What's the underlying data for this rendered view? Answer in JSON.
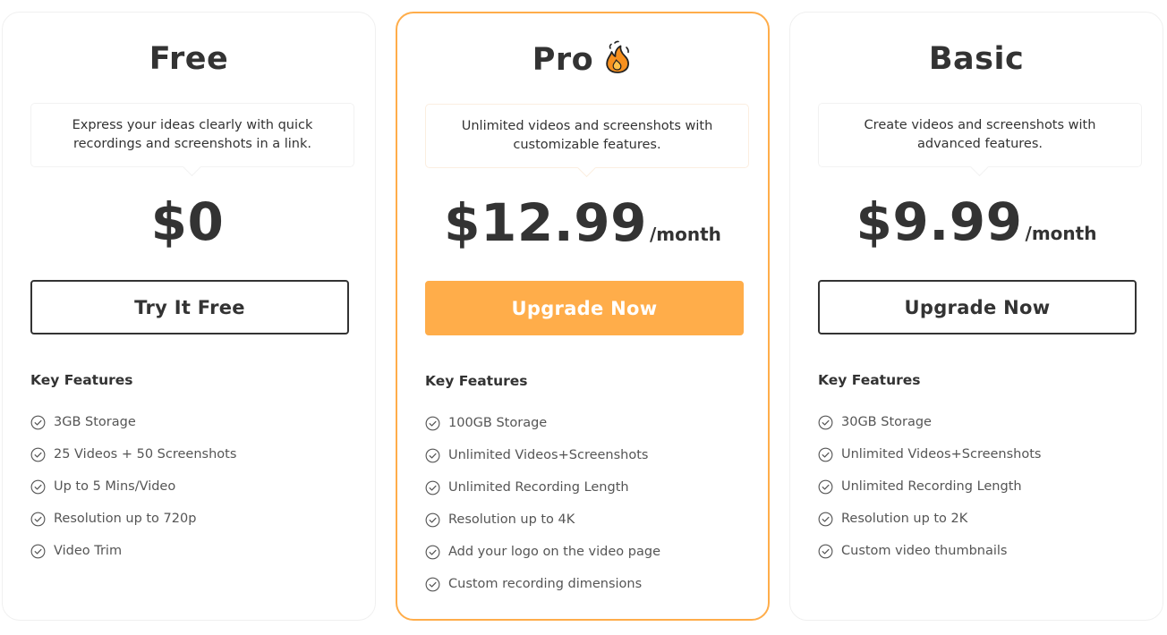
{
  "accent_color": "#ffad4a",
  "text_color": "#333333",
  "plans": [
    {
      "name": "Free",
      "description": "Express your ideas clearly with quick recordings and screenshots in a link.",
      "price": "$0",
      "period": "",
      "cta_label": "Try It Free",
      "features_title": "Key Features",
      "features": [
        "3GB Storage",
        "25 Videos + 50 Screenshots",
        "Up to 5 Mins/Video",
        "Resolution up to 720p",
        "Video Trim"
      ]
    },
    {
      "name": "Pro",
      "badge_icon": "flame-icon",
      "description": "Unlimited videos and screenshots with customizable features.",
      "price": "$12.99",
      "period": "/month",
      "cta_label": "Upgrade Now",
      "features_title": "Key Features",
      "features": [
        "100GB Storage",
        "Unlimited Videos+Screenshots",
        "Unlimited Recording Length",
        "Resolution up to 4K",
        "Add your logo on the video page",
        "Custom recording dimensions"
      ]
    },
    {
      "name": "Basic",
      "description": "Create videos and screenshots with advanced features.",
      "price": "$9.99",
      "period": "/month",
      "cta_label": "Upgrade Now",
      "features_title": "Key Features",
      "features": [
        "30GB Storage",
        "Unlimited Videos+Screenshots",
        "Unlimited Recording Length",
        "Resolution up to 2K",
        "Custom video thumbnails"
      ]
    }
  ]
}
